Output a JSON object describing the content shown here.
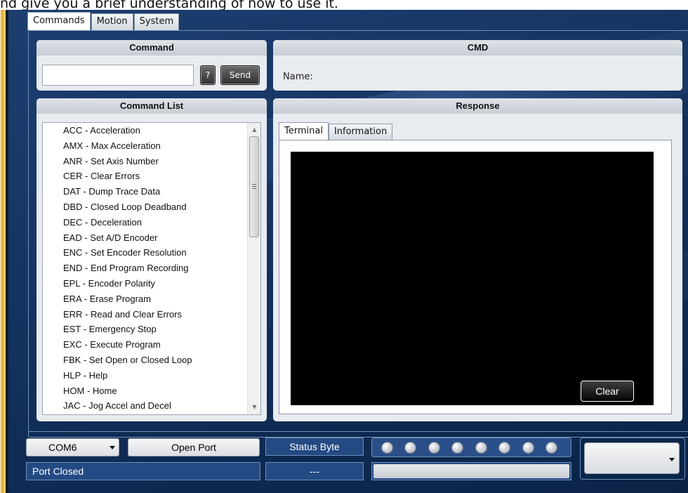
{
  "caption": "nd give you a brief understanding of how to use it.",
  "main_tabs": [
    {
      "label": "Commands",
      "active": true
    },
    {
      "label": "Motion",
      "active": false
    },
    {
      "label": "System",
      "active": false
    }
  ],
  "command_panel": {
    "title": "Command",
    "input_value": "",
    "help_label": "?",
    "send_label": "Send"
  },
  "cmd_panel": {
    "title": "CMD",
    "name_label": "Name:"
  },
  "command_list": {
    "title": "Command List",
    "items": [
      "ACC - Acceleration",
      "AMX - Max Acceleration",
      "ANR - Set Axis Number",
      "CER - Clear Errors",
      "DAT - Dump Trace Data",
      "DBD - Closed Loop Deadband",
      "DEC - Deceleration",
      "EAD - Set A/D Encoder",
      "ENC - Set Encoder Resolution",
      "END - End Program Recording",
      "EPL - Encoder Polarity",
      "ERA - Erase Program",
      "ERR - Read and Clear Errors",
      "EST - Emergency Stop",
      "EXC - Execute Program",
      "FBK - Set Open or Closed Loop",
      "HLP - Help",
      "HOM - Home",
      "JAC - Jog Accel and Decel"
    ]
  },
  "response_panel": {
    "title": "Response",
    "tabs": [
      {
        "label": "Terminal",
        "active": true
      },
      {
        "label": "Information",
        "active": false
      }
    ],
    "clear_label": "Clear"
  },
  "bottom": {
    "com_port": "COM6",
    "open_port_label": "Open Port",
    "port_status": "Port Closed",
    "status_byte_label": "Status Byte",
    "status_byte_value": "---",
    "led_count": 8,
    "right_select_value": ""
  },
  "colors": {
    "window_bg": "#163563",
    "panel_bg": "#e8ebf0",
    "status_box_bg": "#234a82",
    "terminal_bg": "#000000"
  }
}
